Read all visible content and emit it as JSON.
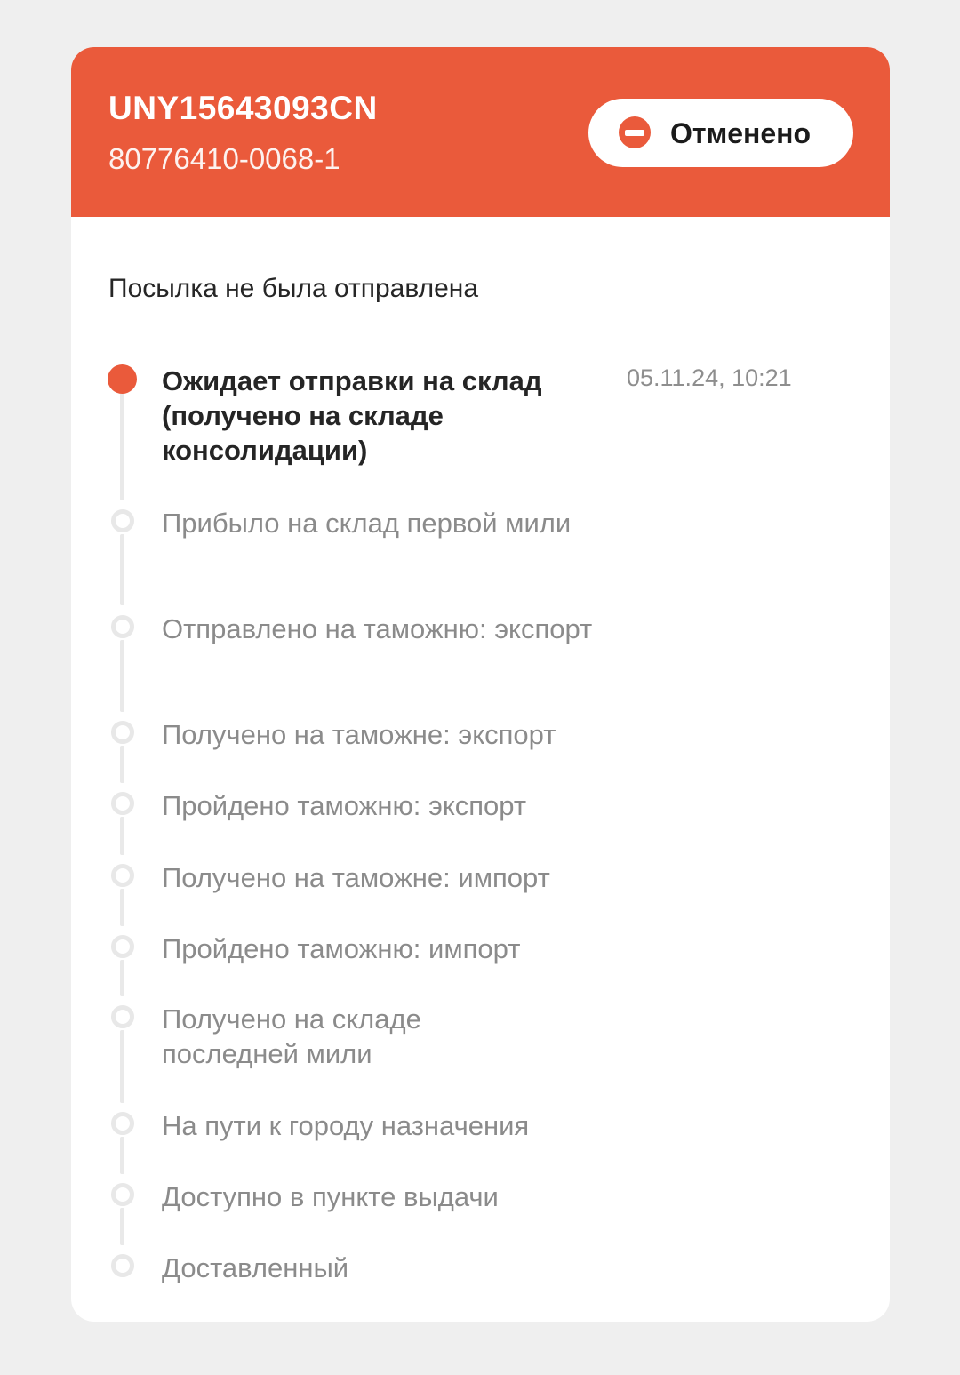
{
  "header": {
    "tracking_number": "UNY15643093CN",
    "order_number": "80776410-0068-1",
    "status_label": "Отменено",
    "status_icon": "stop-icon",
    "accent_color": "#ea5a3b"
  },
  "subtitle": "Посылка не была отправлена",
  "timeline": [
    {
      "label": "Ожидает отправки на склад (получено на складе консолидации)",
      "time": "05.11.24, 10:21",
      "active": true
    },
    {
      "label": "Прибыло на склад первой мили",
      "active": false
    },
    {
      "label": "Отправлено на таможню: экспорт",
      "active": false
    },
    {
      "label": "Получено на таможне: экспорт",
      "active": false
    },
    {
      "label": "Пройдено таможню: экспорт",
      "active": false
    },
    {
      "label": "Получено на таможне: импорт",
      "active": false
    },
    {
      "label": "Пройдено таможню: импорт",
      "active": false
    },
    {
      "label": "Получено на складе последней мили",
      "active": false
    },
    {
      "label": "На пути к городу назначения",
      "active": false
    },
    {
      "label": "Доступно в пункте выдачи",
      "active": false
    },
    {
      "label": "Доставленный",
      "active": false
    }
  ]
}
